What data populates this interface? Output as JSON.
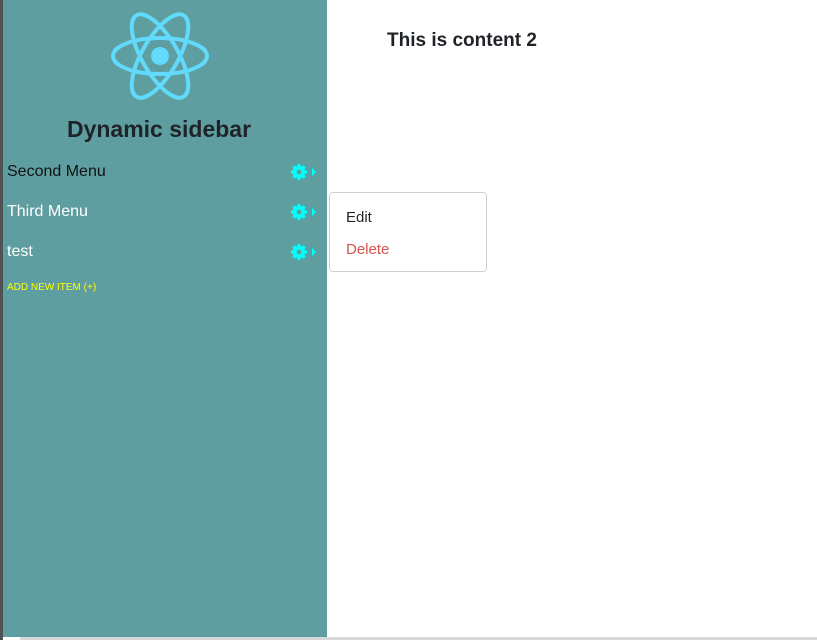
{
  "sidebar": {
    "title": "Dynamic sidebar",
    "items": [
      {
        "label": "Second Menu"
      },
      {
        "label": "Third Menu"
      },
      {
        "label": "test"
      }
    ],
    "add_new_label": "ADD NEW ITEM (+)",
    "logo_icon": "react-logo-icon",
    "action_icon": "gear-icon"
  },
  "content": {
    "title": "This is content 2"
  },
  "dropdown": {
    "edit_label": "Edit",
    "delete_label": "Delete"
  },
  "colors": {
    "sidebar_bg": "#5f9ea0",
    "logo": "#61dafb",
    "gear": "#00ffff",
    "add_new": "#ffff00",
    "delete": "#d9534f"
  }
}
